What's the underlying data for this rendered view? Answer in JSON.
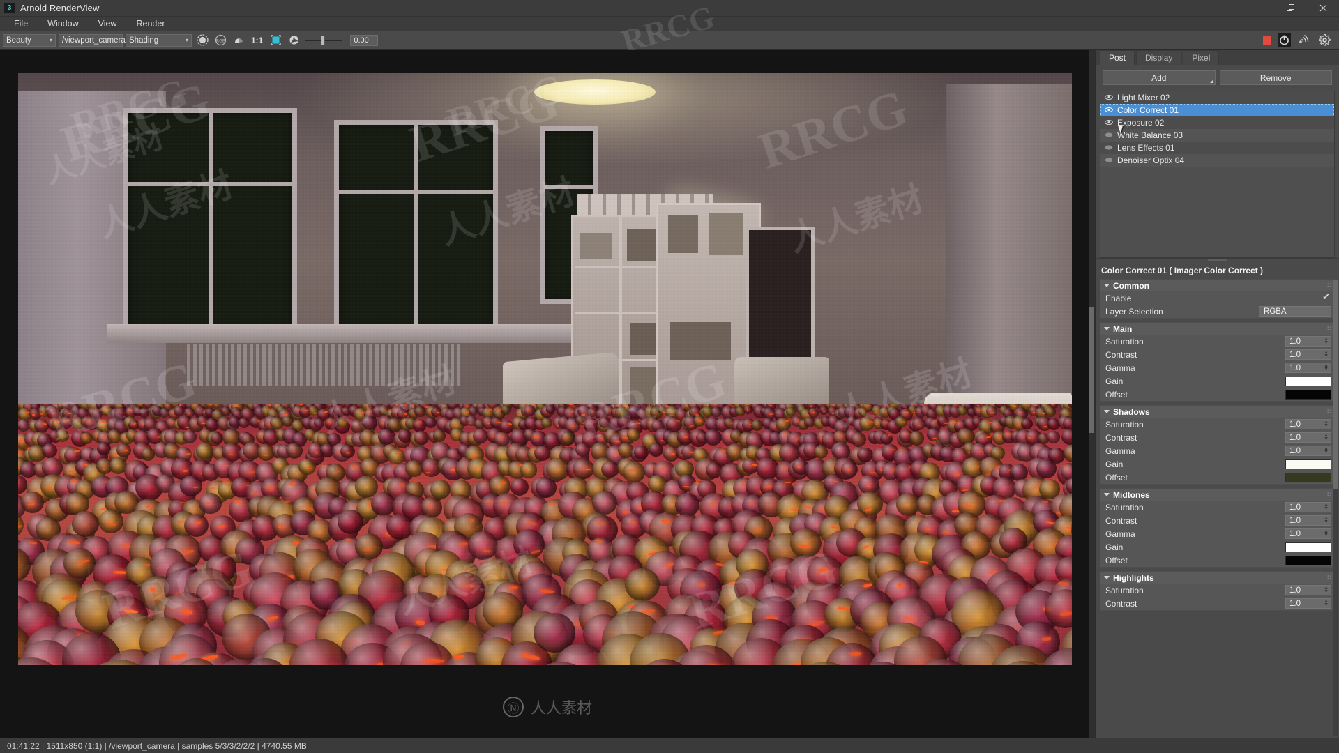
{
  "window": {
    "title": "Arnold RenderView",
    "app_icon": "arnold-icon",
    "minimize": "—",
    "maximize": "❐",
    "close": "✕"
  },
  "menubar": {
    "items": [
      {
        "label": "File"
      },
      {
        "label": "Window"
      },
      {
        "label": "View"
      },
      {
        "label": "Render"
      }
    ]
  },
  "toolbar": {
    "aov_combo": {
      "value": "Beauty",
      "caret": "▾"
    },
    "camera_combo": {
      "value": "/viewport_camera",
      "caret": "▾"
    },
    "shading_combo": {
      "value": "Shading",
      "caret": "▾"
    },
    "zoom_ratio": "1:1",
    "exposure_value": "0.00",
    "icons": {
      "render_sphere": "render-sphere-icon",
      "rgb_channels": "RGB",
      "alpha_channel": "alpha-channel-icon",
      "crop_region": "crop-region-icon",
      "aperture": "aperture-icon"
    },
    "right_icons": {
      "stop": "stop-square-icon",
      "ipr_render": "ipr-render-icon",
      "broadcast": "broadcast-icon",
      "settings": "gear-icon"
    }
  },
  "render": {
    "resolution": "1511x850",
    "scale": "(1:1)"
  },
  "post_panel": {
    "tabs": [
      {
        "label": "Post",
        "active": true
      },
      {
        "label": "Display",
        "active": false
      },
      {
        "label": "Pixel",
        "active": false
      }
    ],
    "add_label": "Add",
    "remove_label": "Remove",
    "layers": [
      {
        "name": "Light Mixer 02",
        "visible": true,
        "selected": false
      },
      {
        "name": "Color Correct 01",
        "visible": true,
        "selected": true
      },
      {
        "name": "Exposure 02",
        "visible": true,
        "selected": false
      },
      {
        "name": "White Balance 03",
        "visible": true,
        "selected": false
      },
      {
        "name": "Lens Effects 01",
        "visible": true,
        "selected": false
      },
      {
        "name": "Denoiser Optix 04",
        "visible": true,
        "selected": false
      }
    ]
  },
  "properties": {
    "header": "Color Correct 01  ( Imager Color Correct )",
    "groups": [
      {
        "title": "Common",
        "rows": [
          {
            "label": "Enable",
            "type": "checkbox",
            "value": "checked"
          },
          {
            "label": "Layer Selection",
            "type": "text",
            "value": "RGBA"
          }
        ]
      },
      {
        "title": "Main",
        "rows": [
          {
            "label": "Saturation",
            "type": "spinner",
            "value": "1.0"
          },
          {
            "label": "Contrast",
            "type": "spinner",
            "value": "1.0"
          },
          {
            "label": "Gamma",
            "type": "spinner",
            "value": "1.0"
          },
          {
            "label": "Gain",
            "type": "color",
            "value": "#ffffff"
          },
          {
            "label": "Offset",
            "type": "color",
            "value": "#050505"
          }
        ]
      },
      {
        "title": "Shadows",
        "rows": [
          {
            "label": "Saturation",
            "type": "spinner",
            "value": "1.0"
          },
          {
            "label": "Contrast",
            "type": "spinner",
            "value": "1.0"
          },
          {
            "label": "Gamma",
            "type": "spinner",
            "value": "1.0"
          },
          {
            "label": "Gain",
            "type": "color",
            "value": "#fbfbf4"
          },
          {
            "label": "Offset",
            "type": "color",
            "value": "#35391f"
          }
        ]
      },
      {
        "title": "Midtones",
        "rows": [
          {
            "label": "Saturation",
            "type": "spinner",
            "value": "1.0"
          },
          {
            "label": "Contrast",
            "type": "spinner",
            "value": "1.0"
          },
          {
            "label": "Gamma",
            "type": "spinner",
            "value": "1.0"
          },
          {
            "label": "Gain",
            "type": "color",
            "value": "#ffffff"
          },
          {
            "label": "Offset",
            "type": "color",
            "value": "#050505"
          }
        ]
      },
      {
        "title": "Highlights",
        "rows": [
          {
            "label": "Saturation",
            "type": "spinner",
            "value": "1.0"
          },
          {
            "label": "Contrast",
            "type": "spinner",
            "value": "1.0"
          }
        ]
      }
    ]
  },
  "statusbar": {
    "text": "01:41:22 | 1511x850 (1:1) | /viewport_camera  | samples 5/3/3/2/2/2 | 4740.55 MB",
    "elapsed": "01:41:22",
    "resolution": "1511x850 (1:1)",
    "camera": "/viewport_camera",
    "samples": "samples 5/3/3/2/2/2",
    "memory": "4740.55 MB"
  },
  "watermarks": {
    "latin": "RRCG",
    "chinese": "人人素材",
    "logo_text": "人人素材",
    "logo_mark": "Ⓝ"
  },
  "colors": {
    "accent_selection": "#4a8fd4",
    "stop_red": "#e04b3d",
    "crop_cyan": "#2fc2d6",
    "panel_bg": "#4a4a4a",
    "viewport_bg": "#141414"
  }
}
